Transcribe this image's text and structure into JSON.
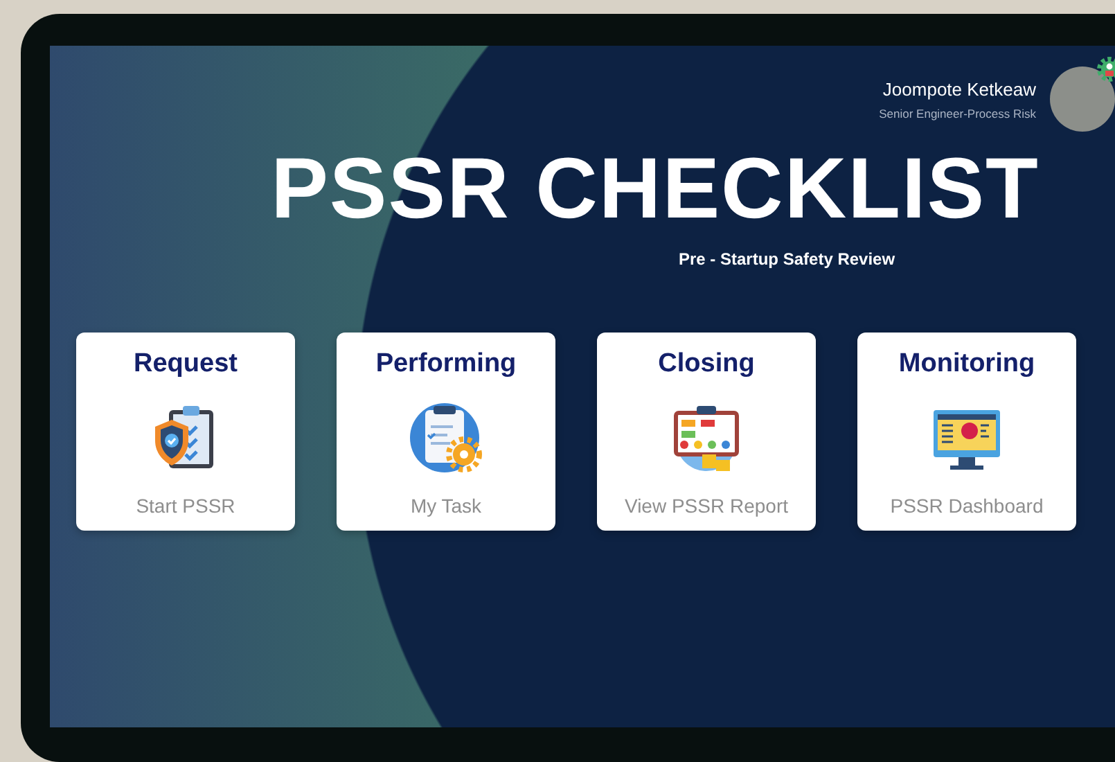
{
  "user": {
    "name": "Joompote Ketkeaw",
    "role": "Senior Engineer-Process Risk"
  },
  "title": "PSSR CHECKLIST",
  "subtitle": "Pre - Startup Safety Review",
  "cards": [
    {
      "title": "Request",
      "action": "Start PSSR"
    },
    {
      "title": "Performing",
      "action": "My Task"
    },
    {
      "title": "Closing",
      "action": "View PSSR Report"
    },
    {
      "title": "Monitoring",
      "action": "PSSR Dashboard"
    }
  ]
}
